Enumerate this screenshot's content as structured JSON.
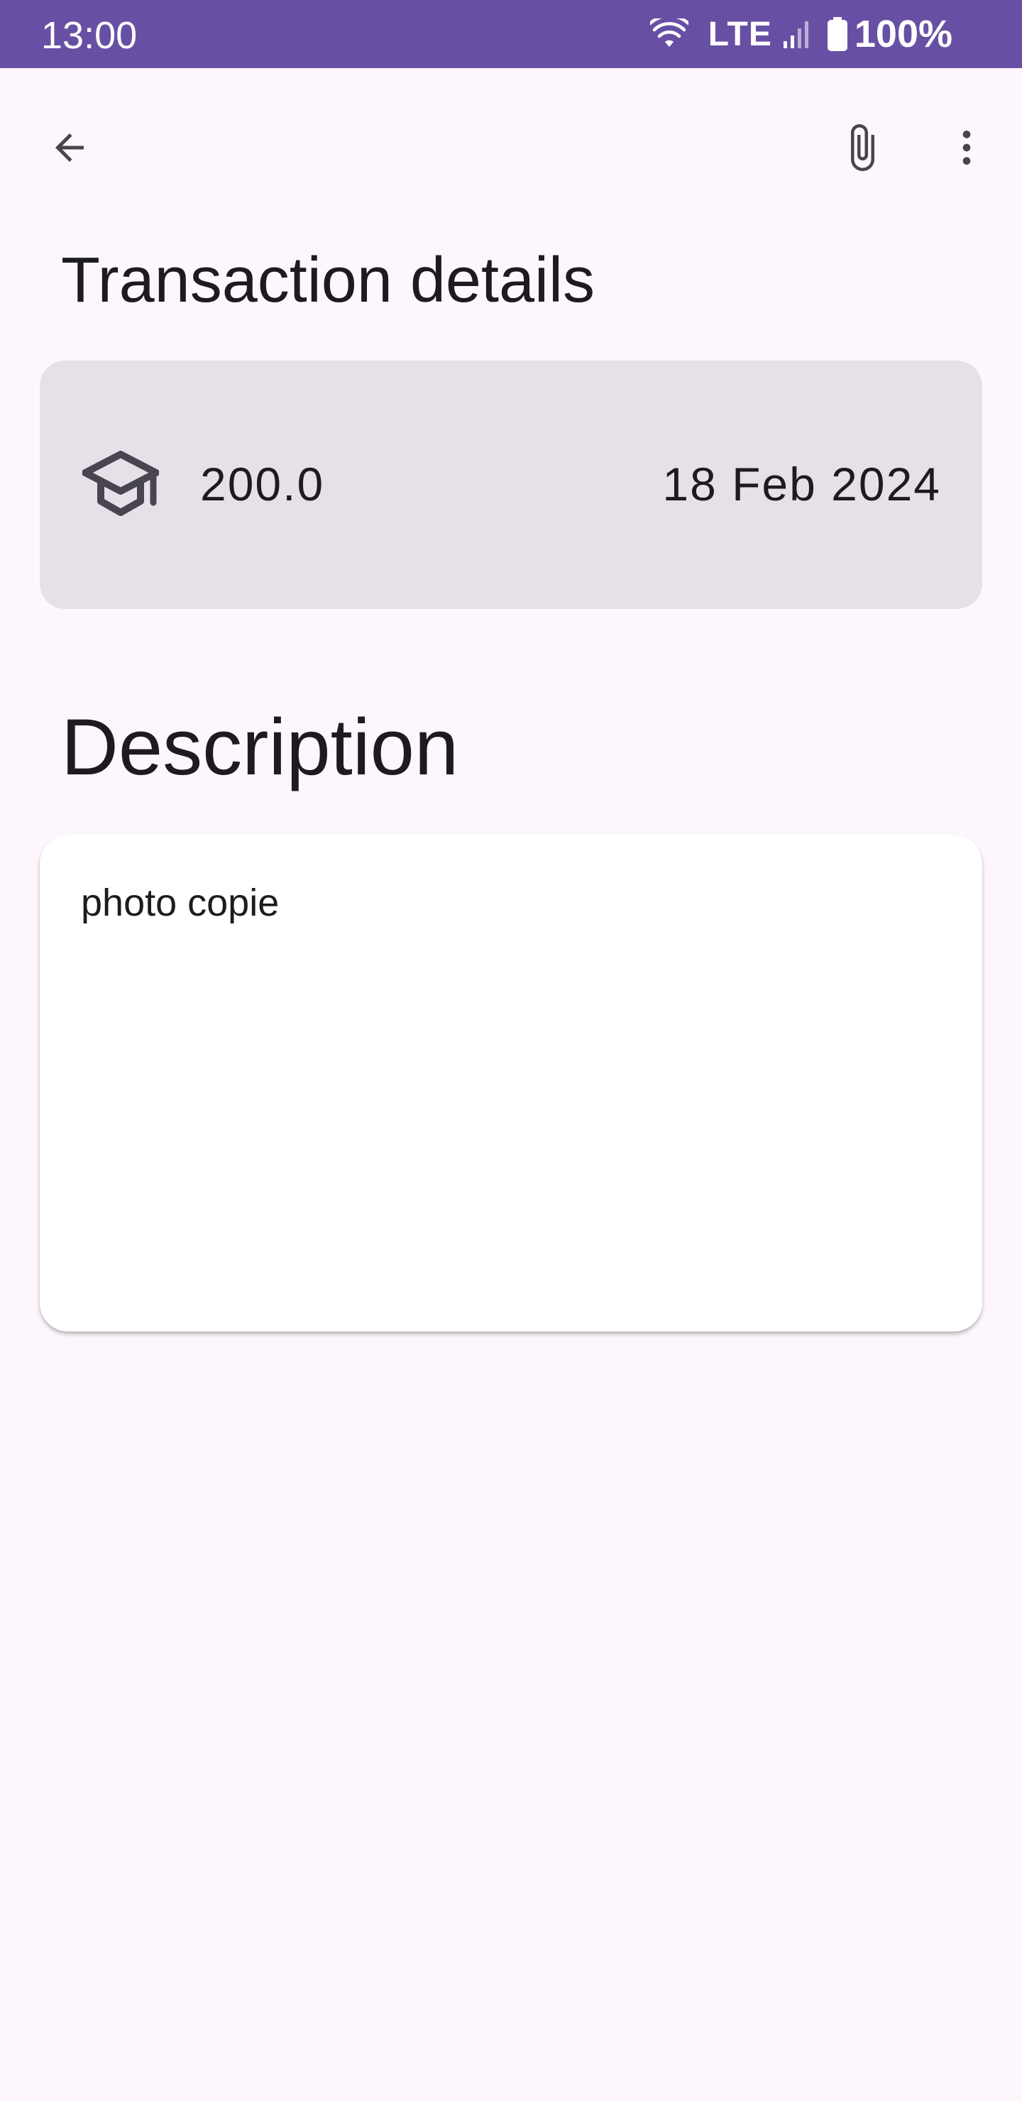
{
  "status_bar": {
    "time": "13:00",
    "network": "LTE",
    "battery": "100%",
    "background_color": "#6750a4"
  },
  "app_bar": {
    "back_icon": "arrow-back-icon",
    "attach_icon": "paperclip-icon",
    "more_icon": "more-vert-icon"
  },
  "page": {
    "title": "Transaction details"
  },
  "transaction": {
    "category_icon": "graduation-cap-icon",
    "amount": "200.0",
    "date": "18 Feb 2024",
    "card_color": "#e6e0e9"
  },
  "description": {
    "heading": "Description",
    "text": "photo copie"
  },
  "theme": {
    "background": "#fdf7fd",
    "text": "#1d1b20",
    "icon": "#49454f"
  }
}
